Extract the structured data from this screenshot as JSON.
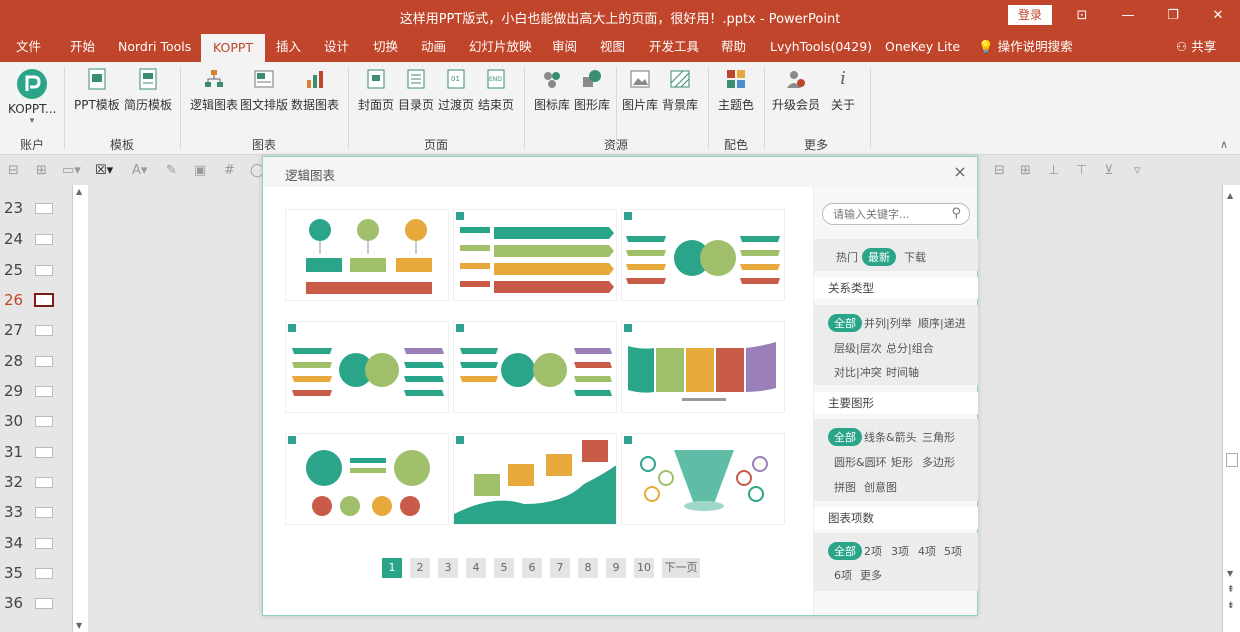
{
  "app": {
    "title": "这样用PPT版式，小白也能做出高大上的页面，很好用！.pptx - PowerPoint",
    "login": "登录"
  },
  "menu": [
    "文件",
    "开始",
    "Nordri Tools",
    "KOPPT",
    "插入",
    "设计",
    "切换",
    "动画",
    "幻灯片放映",
    "审阅",
    "视图",
    "开发工具",
    "帮助",
    "LvyhTools(0429)",
    "OneKey Lite",
    "操作说明搜索",
    "共享"
  ],
  "ribbon": {
    "koppt_label": "KOPPT...",
    "groups": [
      "账户",
      "模板",
      "图表",
      "页面",
      "资源",
      "配色",
      "更多"
    ],
    "buttons": [
      "PPT模板",
      "简历模板",
      "逻辑图表",
      "图文排版",
      "数据图表",
      "封面页",
      "目录页",
      "过渡页",
      "结束页",
      "图标库",
      "图形库",
      "图片库",
      "背景库",
      "主题色",
      "升级会员",
      "关于"
    ]
  },
  "slides": [
    "23",
    "24",
    "25",
    "26",
    "27",
    "28",
    "29",
    "30",
    "31",
    "32",
    "33",
    "34",
    "35",
    "36"
  ],
  "dialog": {
    "title": "逻辑图表",
    "search_placeholder": "请输入关键字...",
    "tabs": [
      "热门",
      "最新",
      "下载"
    ],
    "sections": [
      {
        "title": "关系类型",
        "items": [
          "全部",
          "并列|列举",
          "顺序|递进",
          "层级|层次",
          "总分|组合",
          "对比|冲突",
          "时间轴"
        ]
      },
      {
        "title": "主要图形",
        "items": [
          "全部",
          "线条&箭头",
          "三角形",
          "圆形&圆环",
          "矩形",
          "多边形",
          "拼图",
          "创意图"
        ]
      },
      {
        "title": "图表项数",
        "items": [
          "全部",
          "2项",
          "3项",
          "4项",
          "5项",
          "6项",
          "更多"
        ]
      }
    ],
    "pages": [
      "1",
      "2",
      "3",
      "4",
      "5",
      "6",
      "7",
      "8",
      "9",
      "10"
    ],
    "next": "下一页"
  },
  "colors": {
    "brand": "#c0452a",
    "accent": "#2aa58a"
  }
}
